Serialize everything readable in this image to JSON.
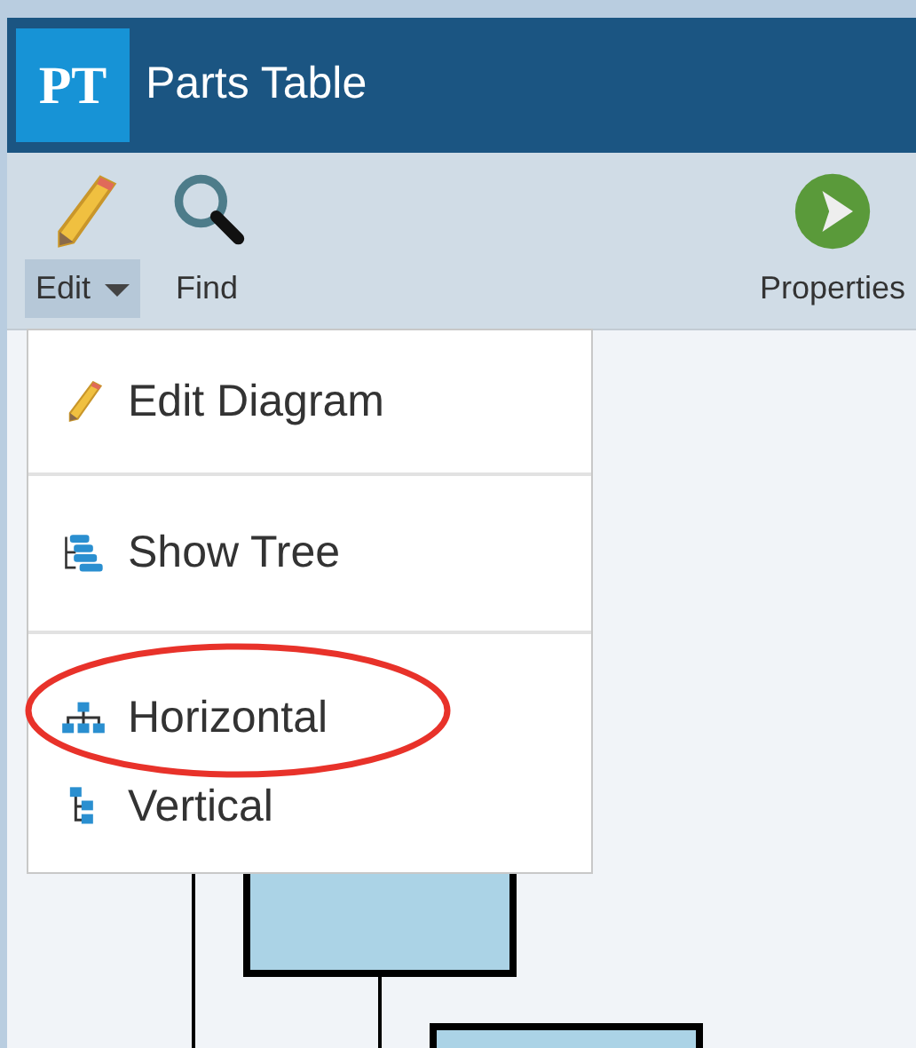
{
  "window": {
    "logo": "PT",
    "title": "Parts Table"
  },
  "toolbar": [
    {
      "label": "Edit",
      "kind": "pencil",
      "dropdown": true,
      "expanded": true
    },
    {
      "label": "Find",
      "kind": "search",
      "dropdown": false,
      "expanded": false
    },
    {
      "label": "Properties",
      "kind": "play",
      "dropdown": false,
      "expanded": false
    }
  ],
  "menu": {
    "sections": [
      [
        {
          "label": "Edit Diagram",
          "kind": "pencil"
        }
      ],
      [
        {
          "label": "Show Tree",
          "kind": "tree"
        }
      ],
      [
        {
          "label": "Horizontal",
          "kind": "horizontal"
        },
        {
          "label": "Vertical",
          "kind": "vertical"
        }
      ]
    ]
  }
}
